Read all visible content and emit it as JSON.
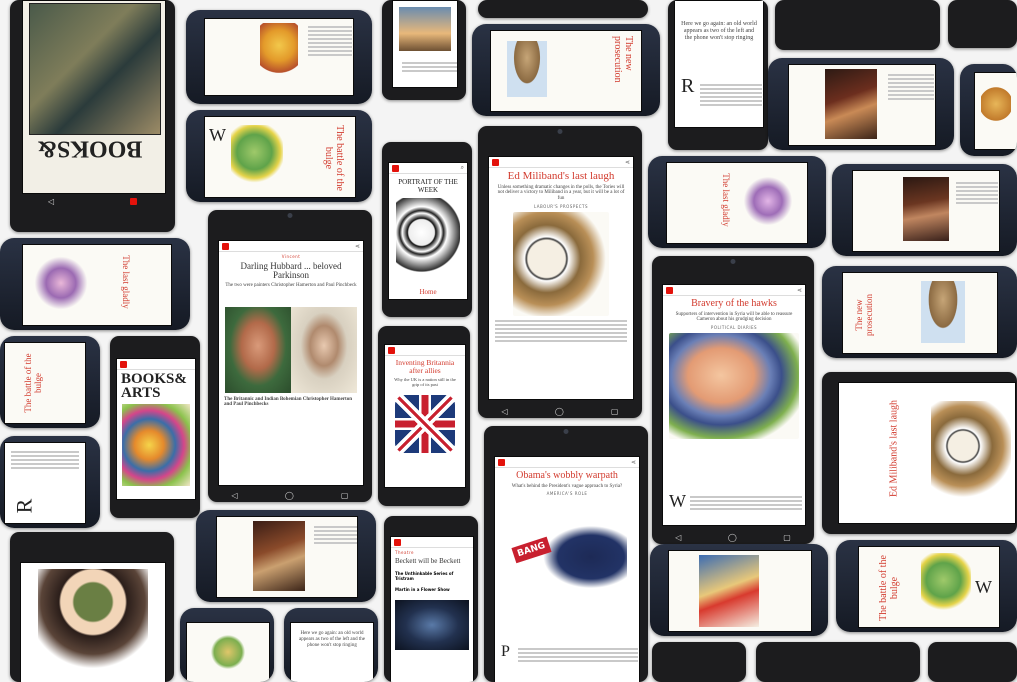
{
  "brand_color": "#e3120b",
  "headline_color": "#d23b2e",
  "icons": {
    "back": "back-arrow-icon",
    "home": "home-icon",
    "recent": "recent-apps-icon",
    "logo": "economist-logo-icon"
  },
  "devices": {
    "center_left": {
      "kicker": "Vincent",
      "headline": "Darling Hubbard ... beloved Parkinson",
      "caption": "The Britannic and Indian Bohemian Christopher Hamerton and Paul Pinchbecks",
      "standfirst": "The two were painters Christopher Hamerton and Paul Pinchbeck"
    },
    "center": {
      "headline": "Ed Miliband's last laugh",
      "standfirst": "Unless something dramatic changes in the polls, the Tories will not deliver a victory to Miliband in a year, but it will be a lot of fun",
      "byline": "LABOUR'S PROSPECTS"
    },
    "center_right": {
      "headline": "Bravery of the hawks",
      "standfirst": "Supporters of intervention in Syria will be able to reassure Cameron about his grudging decision",
      "byline": "POLITICAL DIARIES"
    },
    "bottom_center": {
      "headline": "Obama's wobbly warpath",
      "standfirst": "What's behind the President's vague approach to Syria?",
      "byline": "AMERICA'S ROLE",
      "sign": "BANG"
    },
    "books_arts": {
      "title_1": "BOOKS",
      "title_2": "ARTS",
      "amp": "&"
    },
    "portrait": {
      "title": "PORTRAIT OF THE WEEK",
      "link": "Home"
    },
    "inventing_britain": {
      "headline": "Inventing Britannia after allies",
      "standfirst": "Why the UK is a nation still in the grip of its past"
    },
    "right_rotated": {
      "headline": "Ed Miliband's last laugh"
    },
    "new_prosecution": {
      "headline": "The new prosecution"
    },
    "battle_bulge": {
      "headline": "The battle of the bulge"
    },
    "last_ditch": {
      "headline": "The last gladly"
    },
    "theatre": {
      "kicker": "Theatre",
      "headline": "Beckett will be Beckett",
      "item_1": "The Unthinkable Series of Tristram",
      "item_2": "Martin in a Flower Show"
    },
    "pull_quote": {
      "text": "Here we go again: an old world appears as two of the left and the phone won't stop ringing"
    }
  }
}
